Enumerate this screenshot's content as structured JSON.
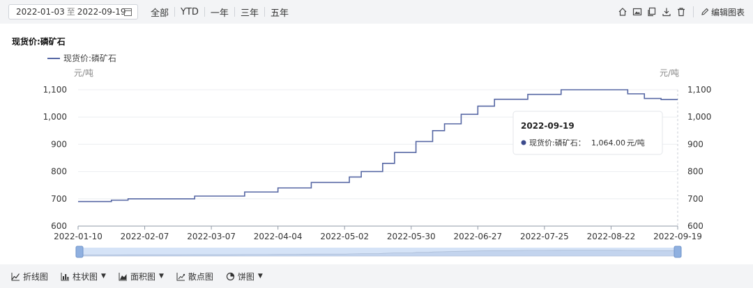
{
  "toolbar": {
    "date_start": "2022-01-03",
    "date_sep": "至",
    "date_end": "2022-09-19",
    "ranges": [
      "全部",
      "YTD",
      "一年",
      "三年",
      "五年"
    ],
    "edit_label": "编辑图表"
  },
  "bottom": {
    "chart_types": [
      {
        "label": "折线图",
        "icon": "line-chart-icon",
        "dropdown": false
      },
      {
        "label": "柱状图",
        "icon": "bar-chart-icon",
        "dropdown": true
      },
      {
        "label": "面积图",
        "icon": "area-chart-icon",
        "dropdown": true
      },
      {
        "label": "散点图",
        "icon": "scatter-chart-icon",
        "dropdown": false
      },
      {
        "label": "饼图",
        "icon": "pie-chart-icon",
        "dropdown": true
      }
    ]
  },
  "colors": {
    "series": "#5566a3",
    "tooltip_dot": "#3b4a8c",
    "slider": "#d5e3f7"
  },
  "chart_data": {
    "type": "line",
    "title": "现货价:磷矿石",
    "unit_left": "元/吨",
    "unit_right": "元/吨",
    "ylim": [
      600,
      1100
    ],
    "yticks": [
      600,
      700,
      800,
      900,
      1000,
      1100
    ],
    "ytick_labels": [
      "600",
      "700",
      "800",
      "900",
      "1,000",
      "1,100"
    ],
    "xticks": [
      "2022-01-10",
      "2022-02-07",
      "2022-03-07",
      "2022-04-04",
      "2022-05-02",
      "2022-05-30",
      "2022-06-27",
      "2022-07-25",
      "2022-08-22",
      "2022-09-19"
    ],
    "legend_position": "top-left",
    "series": [
      {
        "name": "现货价:磷矿石",
        "x": [
          "2022-01-10",
          "2022-01-17",
          "2022-01-24",
          "2022-01-31",
          "2022-02-07",
          "2022-02-14",
          "2022-02-21",
          "2022-02-28",
          "2022-03-07",
          "2022-03-14",
          "2022-03-21",
          "2022-03-28",
          "2022-04-04",
          "2022-04-11",
          "2022-04-18",
          "2022-04-25",
          "2022-05-02",
          "2022-05-04",
          "2022-05-09",
          "2022-05-16",
          "2022-05-18",
          "2022-05-23",
          "2022-05-30",
          "2022-06-01",
          "2022-06-06",
          "2022-06-08",
          "2022-06-13",
          "2022-06-20",
          "2022-06-27",
          "2022-07-04",
          "2022-07-11",
          "2022-07-18",
          "2022-07-25",
          "2022-08-01",
          "2022-08-08",
          "2022-08-15",
          "2022-08-22",
          "2022-08-29",
          "2022-09-05",
          "2022-09-12",
          "2022-09-19"
        ],
        "values": [
          690,
          690,
          695,
          700,
          700,
          700,
          700,
          710,
          710,
          710,
          725,
          725,
          740,
          740,
          760,
          760,
          760,
          780,
          800,
          800,
          830,
          870,
          870,
          910,
          910,
          950,
          975,
          1010,
          1040,
          1065,
          1065,
          1083,
          1083,
          1100,
          1100,
          1100,
          1100,
          1085,
          1068,
          1064,
          1064
        ]
      }
    ],
    "tooltip": {
      "date": "2022-09-19",
      "series_label": "现货价:磷矿石：",
      "value": "1,064.00",
      "unit": "元/吨"
    }
  }
}
